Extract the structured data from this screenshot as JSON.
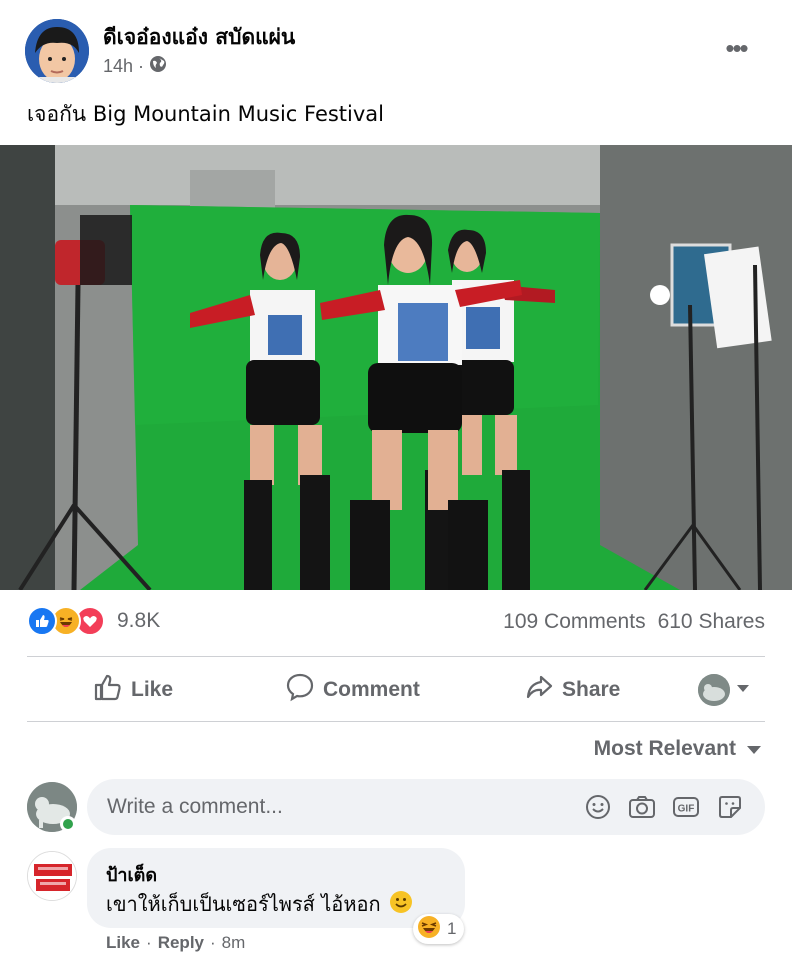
{
  "post": {
    "author": "ดีเจอ๋องแอ๋ง สบัดแผ่น",
    "time": "14h",
    "separator": "·",
    "privacy_icon": "globe-icon",
    "text": "เจอกัน Big Mountain Music Festival"
  },
  "reactions": {
    "icons": [
      "like-icon",
      "haha-icon",
      "love-icon"
    ],
    "count": "9.8K",
    "comments": "109 Comments",
    "shares": "610 Shares"
  },
  "actions": {
    "like": "Like",
    "comment": "Comment",
    "share": "Share"
  },
  "sort": {
    "label": "Most Relevant"
  },
  "composer": {
    "placeholder": "Write a comment..."
  },
  "comment": {
    "name": "ป้าเต็ด",
    "text": "เขาให้เก็บเป็นเซอร์ไพรส์ ไอ้หอก",
    "reaction_count": "1",
    "like": "Like",
    "reply": "Reply",
    "time": "8m",
    "sep": "·"
  },
  "colors": {
    "secondary_text": "#65676b",
    "like_blue": "#1877f2",
    "love_red": "#f33e58",
    "haha_yellow": "#f7b125",
    "bubble_bg": "#f0f2f5",
    "green_screen": "#1faa3a"
  }
}
